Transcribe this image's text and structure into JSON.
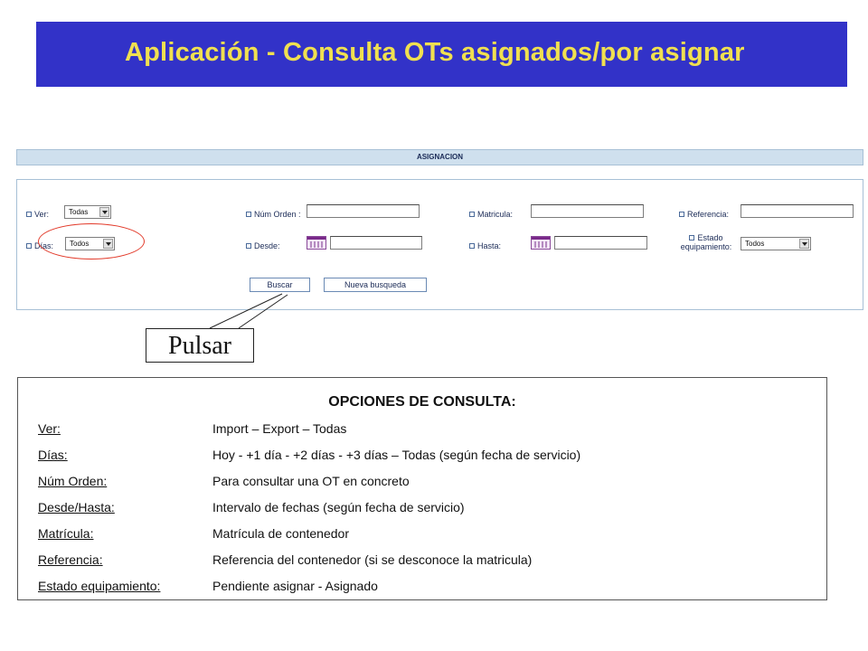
{
  "banner": {
    "title": "Aplicación  - Consulta OTs asignados/por asignar"
  },
  "form": {
    "section_title": "ASIGNACION",
    "ver_label": "Ver:",
    "ver_value": "Todas",
    "dias_label": "Días:",
    "dias_value": "Todos",
    "num_orden_label": "Núm Orden :",
    "num_orden_value": "",
    "desde_label": "Desde:",
    "desde_value": "",
    "matricula_label": "Matricula:",
    "matricula_value": "",
    "hasta_label": "Hasta:",
    "hasta_value": "",
    "referencia_label": "Referencia:",
    "referencia_value": "",
    "estado_label_line1": "Estado",
    "estado_label_line2": "equipamiento:",
    "estado_value": "Todos",
    "buscar_label": "Buscar",
    "nueva_busqueda_label": "Nueva busqueda"
  },
  "callout": {
    "text": "Pulsar"
  },
  "options": {
    "title": "OPCIONES DE CONSULTA:",
    "rows": [
      {
        "key": "Ver",
        "suffix": ":",
        "value": "Import – Export – Todas"
      },
      {
        "key": "Días:",
        "suffix": "",
        "value": "Hoy - +1 día - +2 días - +3 días – Todas (según fecha de servicio)"
      },
      {
        "key": "Núm Orden:",
        "suffix": "",
        "value": "Para consultar una OT en concreto"
      },
      {
        "key": "Desde/Hasta:",
        "suffix": "",
        "value": "Intervalo de fechas (según fecha de servicio)"
      },
      {
        "key": "Matrícula:",
        "suffix": "",
        "value": "Matrícula de contenedor"
      },
      {
        "key": "Referencia:",
        "suffix": "",
        "value": "Referencia del contenedor (si se desconoce la matricula)"
      },
      {
        "key": "Estado equipamiento:",
        "suffix": "",
        "value": "Pendiente asignar - Asignado"
      }
    ]
  }
}
